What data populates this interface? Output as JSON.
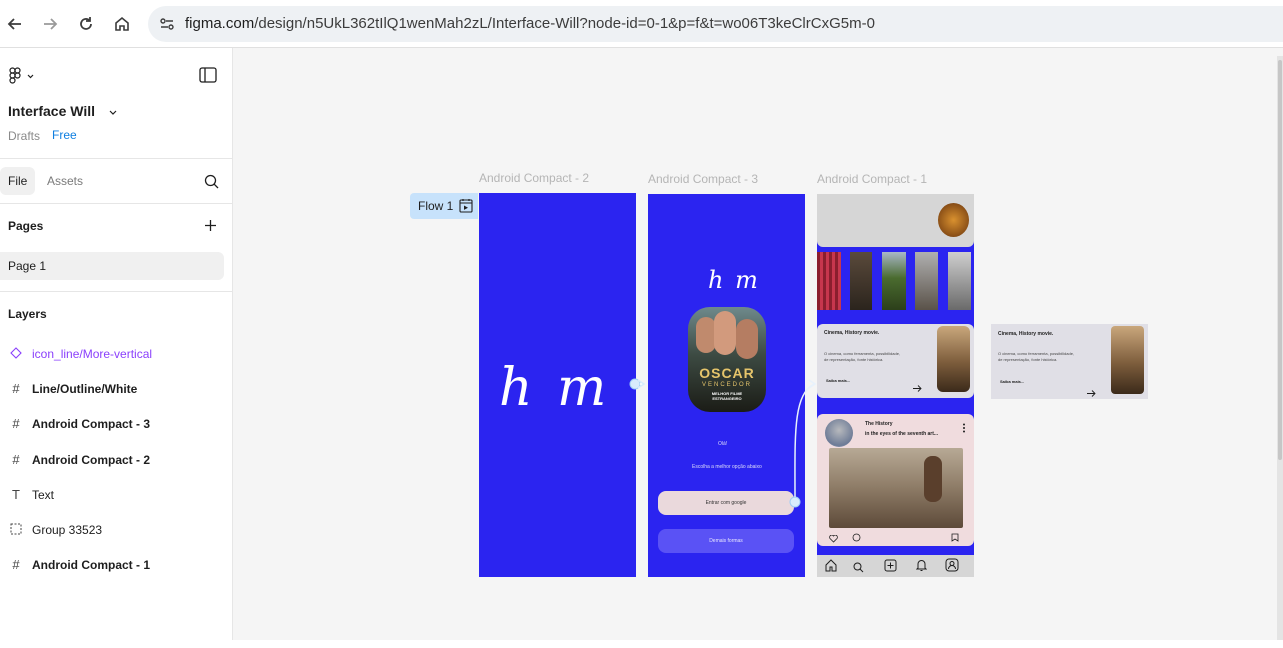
{
  "browser": {
    "url_host": "figma.com",
    "url_path": "/design/n5UkL362tIlQ1wenMah2zL/Interface-Will?node-id=0-1&p=f&t=wo06T3keClrCxG5m-0"
  },
  "sidebar": {
    "file_name": "Interface Will",
    "location": "Drafts",
    "plan_badge": "Free",
    "tabs": {
      "file": "File",
      "assets": "Assets"
    },
    "pages_heading": "Pages",
    "pages": [
      "Page 1"
    ],
    "layers_heading": "Layers",
    "layers": [
      {
        "label": "icon_line/More-vertical",
        "icon": "component-diamond-icon"
      },
      {
        "label": "Line/Outline/White",
        "icon": "frame-hash-icon"
      },
      {
        "label": "Android Compact - 3",
        "icon": "frame-hash-icon"
      },
      {
        "label": "Android Compact - 2",
        "icon": "frame-hash-icon"
      },
      {
        "label": "Text",
        "icon": "text-icon"
      },
      {
        "label": "Group 33523",
        "icon": "group-dashed-icon"
      },
      {
        "label": "Android Compact - 1",
        "icon": "frame-hash-icon"
      }
    ]
  },
  "canvas": {
    "flow_label": "Flow 1",
    "frames": {
      "frame2": {
        "label": "Android Compact - 2",
        "logo": "h m"
      },
      "frame3": {
        "label": "Android Compact - 3",
        "logo": "h m",
        "poster_title": "OSCAR",
        "poster_sub": "VENCEDOR",
        "poster_sub2": "MELHOR FILME ESTRANGEIRO",
        "greeting": "Olá!",
        "prompt": "Escolha a melhor opção abaixo",
        "google_button": "Entrar com google",
        "other_button": "Demais formas"
      },
      "frame1": {
        "label": "Android Compact - 1",
        "card_title": "Cinema, History movie.",
        "card_text_1": "O cinema, como ferramenta, possibilidade,",
        "card_text_2": "de representação, fonte histórica.",
        "card_link": "Saiba mais...",
        "post_title_1": "The History",
        "post_title_2": "in the eyes of the seventh art..."
      },
      "floating_card": {
        "title": "Cinema, History movie.",
        "text_1": "O cinema, como ferramenta, possibilidade,",
        "text_2": "de representação, fonte histórica.",
        "link": "Saiba mais..."
      }
    }
  },
  "colors": {
    "frame_blue": "#2b24f0",
    "accent_purple": "#8a3ffc",
    "badge_blue": "#0d7ee0",
    "flow_blue": "#c7e2fb"
  }
}
